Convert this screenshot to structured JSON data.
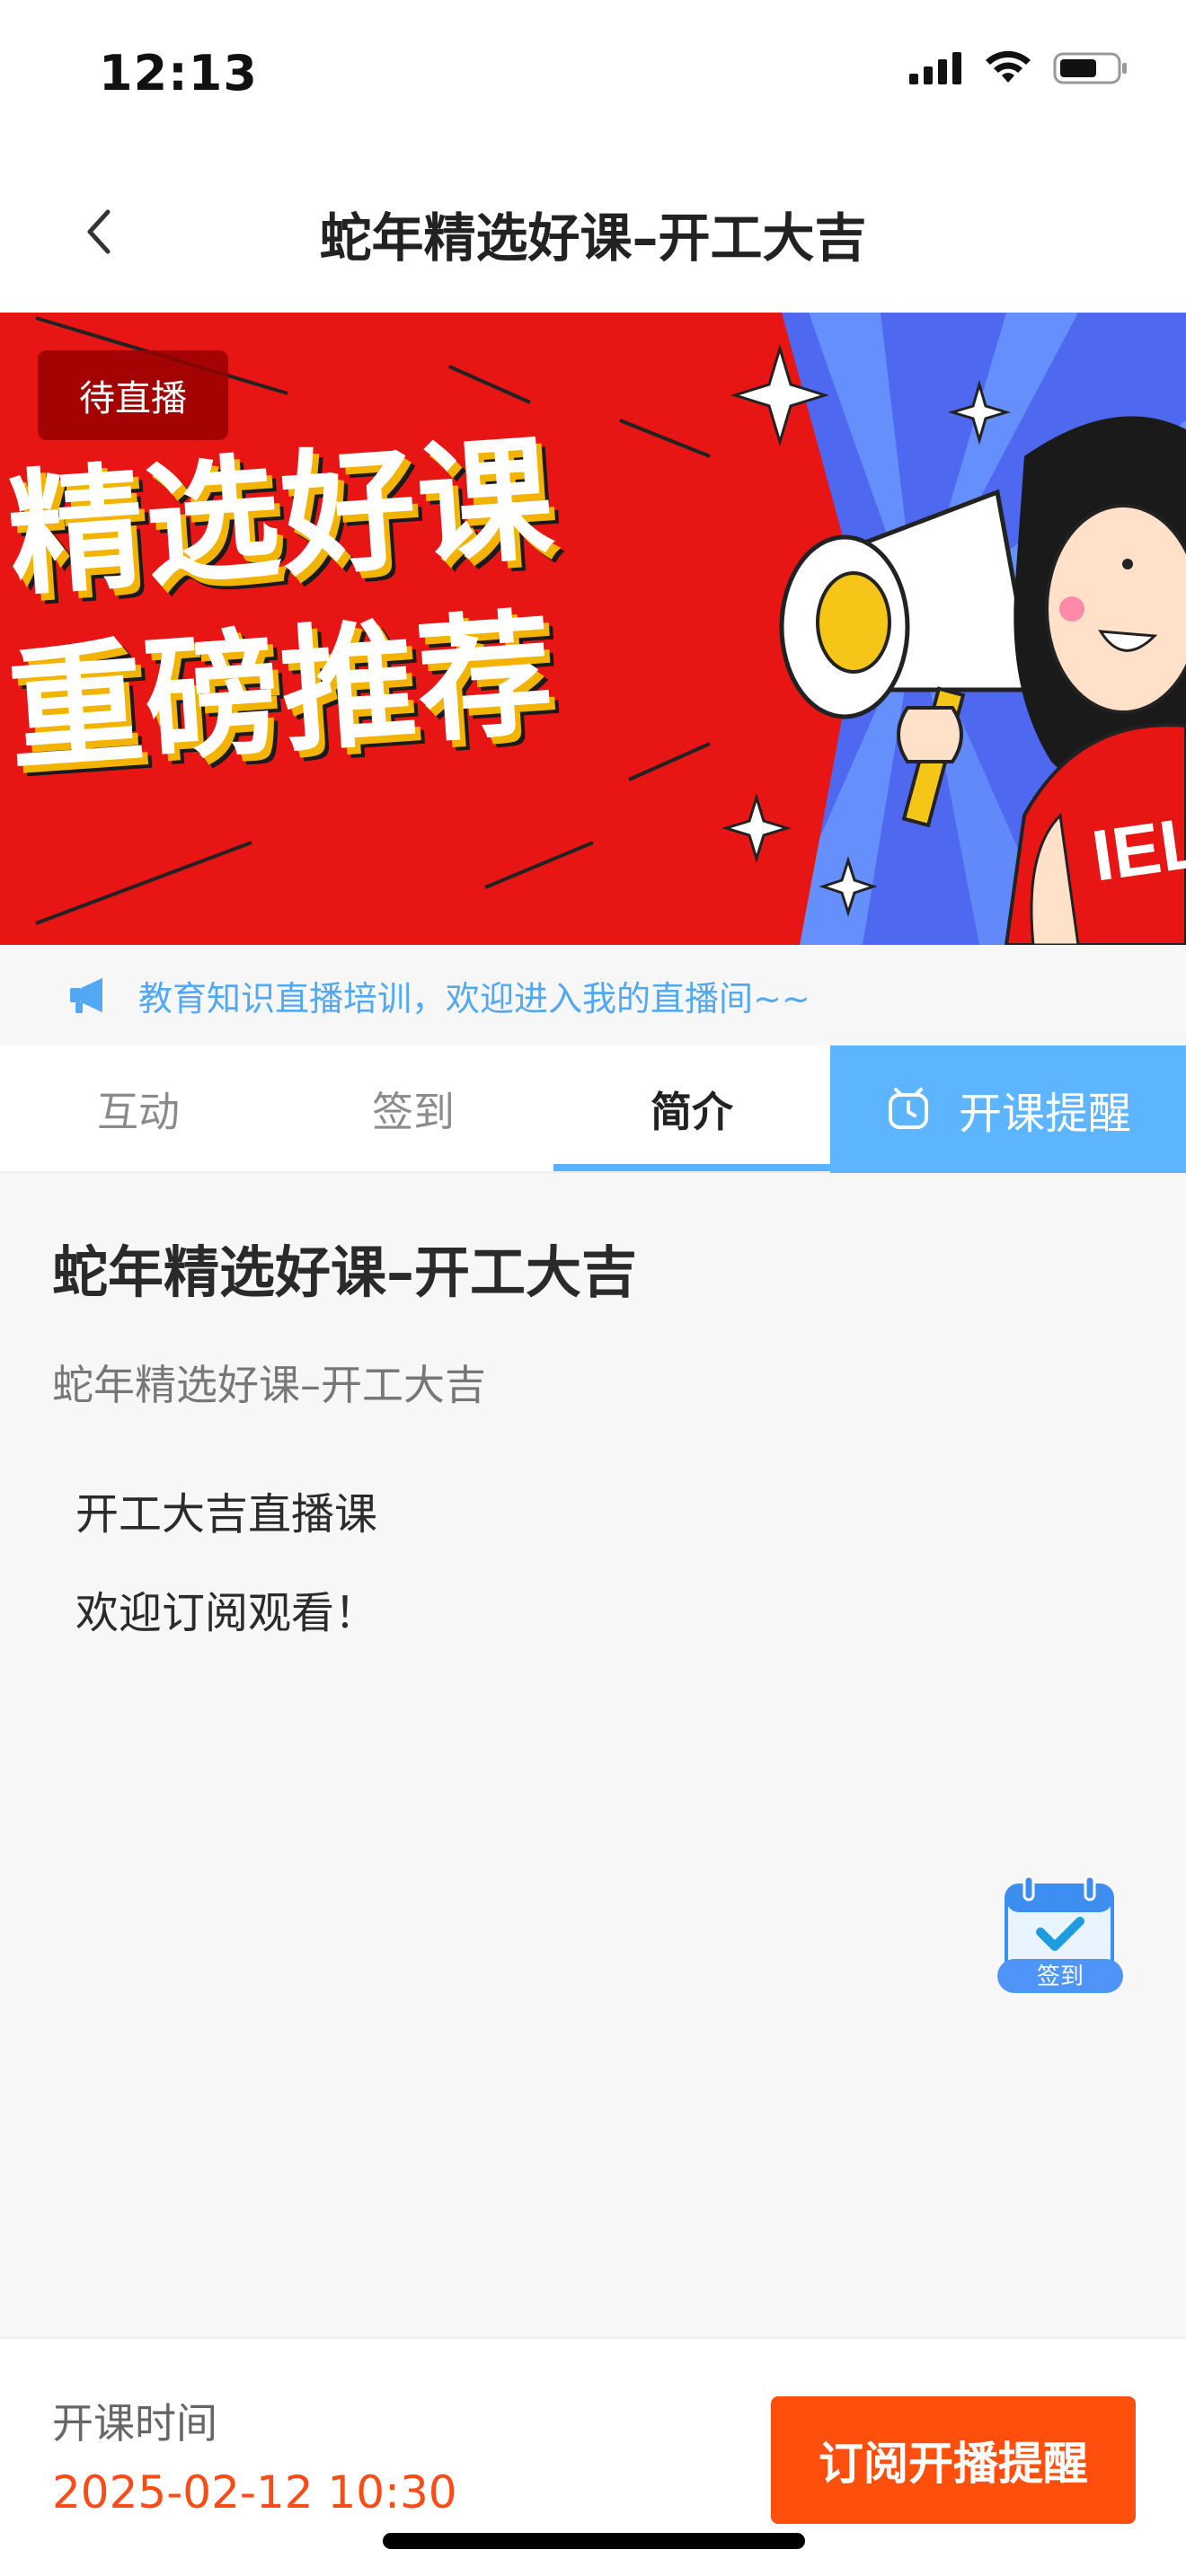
{
  "status_bar": {
    "time": "12:13"
  },
  "nav": {
    "title": "蛇年精选好课–开工大吉",
    "back_icon": "chevron-left-icon"
  },
  "banner": {
    "badge": "待直播",
    "headline_line1": "精选好课",
    "headline_line2": "重磅推荐",
    "shirt_text": "IEL",
    "colors": {
      "red": "#e81515",
      "blue": "#4e68f0",
      "yellow": "#f2b400"
    }
  },
  "notice": {
    "icon": "megaphone-icon",
    "text": "教育知识直播培训，欢迎进入我的直播间~~"
  },
  "tabs": [
    {
      "label": "互动",
      "active": false
    },
    {
      "label": "签到",
      "active": false
    },
    {
      "label": "简介",
      "active": true
    }
  ],
  "reminder_tab": {
    "label": "开课提醒",
    "icon": "alarm-clock-icon",
    "color": "#5db5ff"
  },
  "intro": {
    "title": "蛇年精选好课–开工大吉",
    "subtitle": "蛇年精选好课–开工大吉",
    "lines": [
      "开工大吉直播课",
      "欢迎订阅观看！"
    ]
  },
  "float_checkin": {
    "label": "签到",
    "icon": "calendar-check-icon"
  },
  "bottom": {
    "start_label": "开课时间",
    "start_time": "2025-02-12 10:30",
    "subscribe_label": "订阅开播提醒",
    "accent": "#ff4f0d"
  }
}
